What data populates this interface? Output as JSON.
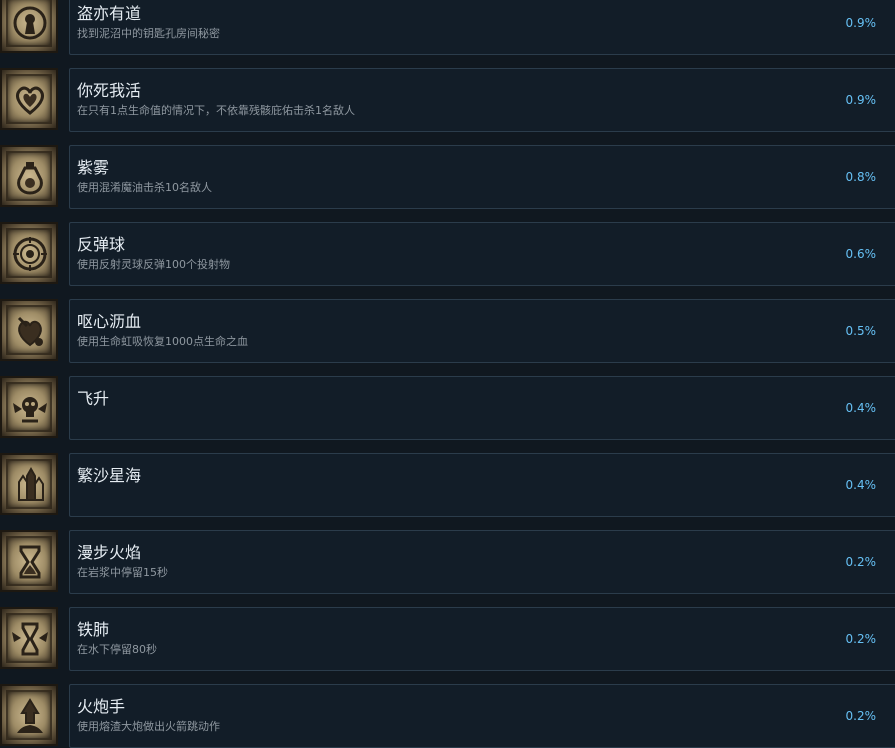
{
  "achievements": [
    {
      "title": "盗亦有道",
      "description": "找到泥沼中的钥匙孔房间秘密",
      "percent": "0.9%",
      "icon": "keyhole-icon"
    },
    {
      "title": "你死我活",
      "description": "在只有1点生命值的情况下，不依靠残骸庇佑击杀1名敌人",
      "percent": "0.9%",
      "icon": "heart-icon"
    },
    {
      "title": "紫雾",
      "description": "使用混淆魔油击杀10名敌人",
      "percent": "0.8%",
      "icon": "potion-icon"
    },
    {
      "title": "反弹球",
      "description": "使用反射灵球反弹100个投射物",
      "percent": "0.6%",
      "icon": "orb-icon"
    },
    {
      "title": "呕心沥血",
      "description": "使用生命虹吸恢复1000点生命之血",
      "percent": "0.5%",
      "icon": "blood-heart-icon"
    },
    {
      "title": "飞升",
      "description": "",
      "percent": "0.4%",
      "icon": "skull-wings-icon"
    },
    {
      "title": "繁沙星海",
      "description": "",
      "percent": "0.4%",
      "icon": "crystals-icon"
    },
    {
      "title": "漫步火焰",
      "description": "在岩浆中停留15秒",
      "percent": "0.2%",
      "icon": "hourglass-flame-icon"
    },
    {
      "title": "铁肺",
      "description": "在水下停留80秒",
      "percent": "0.2%",
      "icon": "hourglass-wings-icon"
    },
    {
      "title": "火炮手",
      "description": "使用熔渣大炮做出火箭跳动作",
      "percent": "0.2%",
      "icon": "rocket-jump-icon"
    }
  ],
  "colors": {
    "background": "#101820",
    "card": "#121d28",
    "card_border": "#2b3c4b",
    "title": "#e6edf3",
    "description": "#8f98a0",
    "percent": "#66c0f4"
  }
}
